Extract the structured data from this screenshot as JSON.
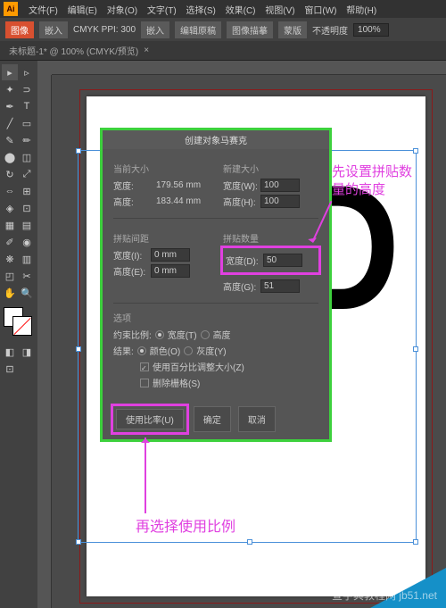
{
  "app": {
    "logo": "Ai"
  },
  "menu": [
    "文件(F)",
    "编辑(E)",
    "对象(O)",
    "文字(T)",
    "选择(S)",
    "效果(C)",
    "视图(V)",
    "窗口(W)",
    "帮助(H)"
  ],
  "options": {
    "mode_label": "图像",
    "embed": "嵌入",
    "color_info": "CMYK PPI: 300",
    "embed2": "嵌入",
    "edit_orig": "编辑原稿",
    "image_desc": "图像描摹",
    "mask": "蒙版",
    "opacity_label": "不透明度",
    "opacity_value": "100%"
  },
  "tab": {
    "title": "未标题-1* @ 100% (CMYK/预览)",
    "close": "×"
  },
  "dialog": {
    "title": "创建对象马赛克",
    "current_size": "当前大小",
    "new_size": "新建大小",
    "width_label": "宽度:",
    "height_label": "高度:",
    "cur_width": "179.56 mm",
    "cur_height": "183.44 mm",
    "new_width_label": "宽度(W):",
    "new_height_label": "高度(H):",
    "new_width": "100",
    "new_height": "100",
    "gap_section": "拼贴间距",
    "count_section": "拼贴数量",
    "gap_w_label": "宽度(I):",
    "gap_h_label": "高度(E):",
    "gap_w": "0 mm",
    "gap_h": "0 mm",
    "count_w_label": "宽度(D):",
    "count_h_label": "高度(G):",
    "count_w": "50",
    "count_h": "51",
    "options": "选项",
    "constrain_label": "约束比例:",
    "constrain_w": "宽度(T)",
    "constrain_h": "高度",
    "result_label": "结果:",
    "result_color": "颜色(O)",
    "result_gray": "灰度(Y)",
    "use_percent": "使用百分比调整大小(Z)",
    "delete_raster": "删除栅格(S)",
    "use_ratio": "使用比率(U)",
    "ok": "确定",
    "cancel": "取消"
  },
  "annotations": {
    "note1": "先设置拼贴数\n量的高度",
    "note2": "再选择使用比例"
  },
  "artwork": {
    "text": "LED"
  },
  "watermark": "查字典教程网 jb51.net"
}
